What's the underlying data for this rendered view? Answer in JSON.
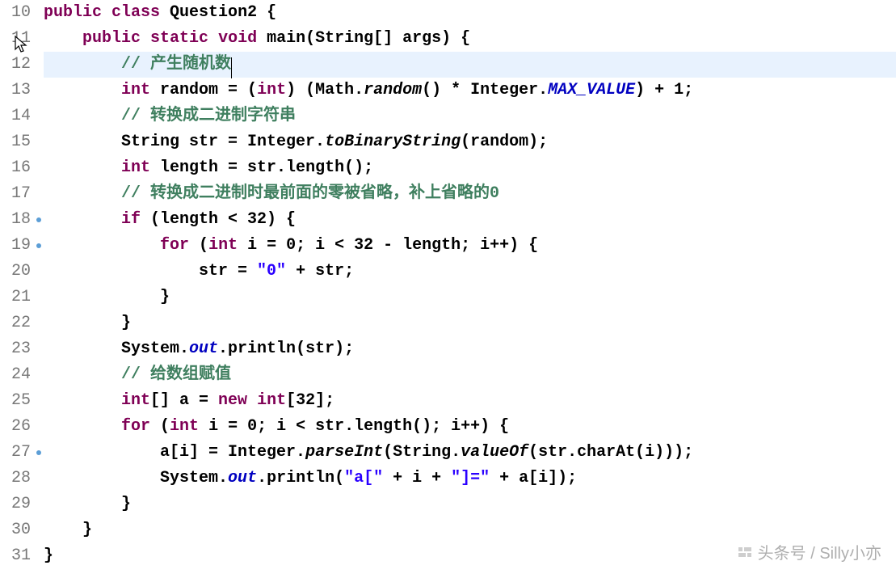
{
  "watermark": "头条号 / Silly小亦",
  "lineStart": 10,
  "highlightLine": 12,
  "markerLines": [
    18,
    19,
    27
  ],
  "foldLines": [
    11
  ],
  "lines": [
    {
      "n": 10,
      "indent": 0,
      "tokens": [
        {
          "t": "kw",
          "v": "public"
        },
        {
          "t": "txt",
          "v": " "
        },
        {
          "t": "kw",
          "v": "class"
        },
        {
          "t": "txt",
          "v": " Question2 {"
        }
      ]
    },
    {
      "n": 11,
      "indent": 1,
      "tokens": [
        {
          "t": "kw",
          "v": "public"
        },
        {
          "t": "txt",
          "v": " "
        },
        {
          "t": "kw",
          "v": "static"
        },
        {
          "t": "txt",
          "v": " "
        },
        {
          "t": "kw",
          "v": "void"
        },
        {
          "t": "txt",
          "v": " main(String[] args) {"
        }
      ]
    },
    {
      "n": 12,
      "indent": 2,
      "hl": true,
      "cursorAfter": true,
      "tokens": [
        {
          "t": "cm",
          "v": "// 产生随机数"
        }
      ]
    },
    {
      "n": 13,
      "indent": 2,
      "tokens": [
        {
          "t": "kw",
          "v": "int"
        },
        {
          "t": "txt",
          "v": " random = ("
        },
        {
          "t": "kw",
          "v": "int"
        },
        {
          "t": "txt",
          "v": ") (Math."
        },
        {
          "t": "smeth",
          "v": "random"
        },
        {
          "t": "txt",
          "v": "() * Integer."
        },
        {
          "t": "sfield",
          "v": "MAX_VALUE"
        },
        {
          "t": "txt",
          "v": ") + 1;"
        }
      ]
    },
    {
      "n": 14,
      "indent": 2,
      "tokens": [
        {
          "t": "cm",
          "v": "// 转换成二进制字符串"
        }
      ]
    },
    {
      "n": 15,
      "indent": 2,
      "tokens": [
        {
          "t": "txt",
          "v": "String str = Integer."
        },
        {
          "t": "smeth",
          "v": "toBinaryString"
        },
        {
          "t": "txt",
          "v": "(random);"
        }
      ]
    },
    {
      "n": 16,
      "indent": 2,
      "tokens": [
        {
          "t": "kw",
          "v": "int"
        },
        {
          "t": "txt",
          "v": " length = str.length();"
        }
      ]
    },
    {
      "n": 17,
      "indent": 2,
      "tokens": [
        {
          "t": "cm",
          "v": "// 转换成二进制时最前面的零被省略，补上省略的0"
        }
      ]
    },
    {
      "n": 18,
      "indent": 2,
      "tokens": [
        {
          "t": "kw",
          "v": "if"
        },
        {
          "t": "txt",
          "v": " (length < 32) {"
        }
      ]
    },
    {
      "n": 19,
      "indent": 3,
      "tokens": [
        {
          "t": "kw",
          "v": "for"
        },
        {
          "t": "txt",
          "v": " ("
        },
        {
          "t": "kw",
          "v": "int"
        },
        {
          "t": "txt",
          "v": " i = 0; i < 32 - length; i++) {"
        }
      ]
    },
    {
      "n": 20,
      "indent": 4,
      "tokens": [
        {
          "t": "txt",
          "v": "str = "
        },
        {
          "t": "str",
          "v": "\"0\""
        },
        {
          "t": "txt",
          "v": " + str;"
        }
      ]
    },
    {
      "n": 21,
      "indent": 3,
      "tokens": [
        {
          "t": "txt",
          "v": "}"
        }
      ]
    },
    {
      "n": 22,
      "indent": 2,
      "tokens": [
        {
          "t": "txt",
          "v": "}"
        }
      ]
    },
    {
      "n": 23,
      "indent": 2,
      "tokens": [
        {
          "t": "txt",
          "v": "System."
        },
        {
          "t": "sfield",
          "v": "out"
        },
        {
          "t": "txt",
          "v": ".println(str);"
        }
      ]
    },
    {
      "n": 24,
      "indent": 2,
      "tokens": [
        {
          "t": "cm",
          "v": "// 给数组赋值"
        }
      ]
    },
    {
      "n": 25,
      "indent": 2,
      "tokens": [
        {
          "t": "kw",
          "v": "int"
        },
        {
          "t": "txt",
          "v": "[] a = "
        },
        {
          "t": "kw",
          "v": "new"
        },
        {
          "t": "txt",
          "v": " "
        },
        {
          "t": "kw",
          "v": "int"
        },
        {
          "t": "txt",
          "v": "[32];"
        }
      ]
    },
    {
      "n": 26,
      "indent": 2,
      "tokens": [
        {
          "t": "kw",
          "v": "for"
        },
        {
          "t": "txt",
          "v": " ("
        },
        {
          "t": "kw",
          "v": "int"
        },
        {
          "t": "txt",
          "v": " i = 0; i < str.length(); i++) {"
        }
      ]
    },
    {
      "n": 27,
      "indent": 3,
      "tokens": [
        {
          "t": "txt",
          "v": "a[i] = Integer."
        },
        {
          "t": "smeth",
          "v": "parseInt"
        },
        {
          "t": "txt",
          "v": "(String."
        },
        {
          "t": "smeth",
          "v": "valueOf"
        },
        {
          "t": "txt",
          "v": "(str.charAt(i)));"
        }
      ]
    },
    {
      "n": 28,
      "indent": 3,
      "tokens": [
        {
          "t": "txt",
          "v": "System."
        },
        {
          "t": "sfield",
          "v": "out"
        },
        {
          "t": "txt",
          "v": ".println("
        },
        {
          "t": "str",
          "v": "\"a[\""
        },
        {
          "t": "txt",
          "v": " + i + "
        },
        {
          "t": "str",
          "v": "\"]=\""
        },
        {
          "t": "txt",
          "v": " + a[i]);"
        }
      ]
    },
    {
      "n": 29,
      "indent": 2,
      "tokens": [
        {
          "t": "txt",
          "v": "}"
        }
      ]
    },
    {
      "n": 30,
      "indent": 1,
      "tokens": [
        {
          "t": "txt",
          "v": "}"
        }
      ]
    },
    {
      "n": 31,
      "indent": 0,
      "tokens": [
        {
          "t": "txt",
          "v": "}"
        }
      ]
    }
  ]
}
